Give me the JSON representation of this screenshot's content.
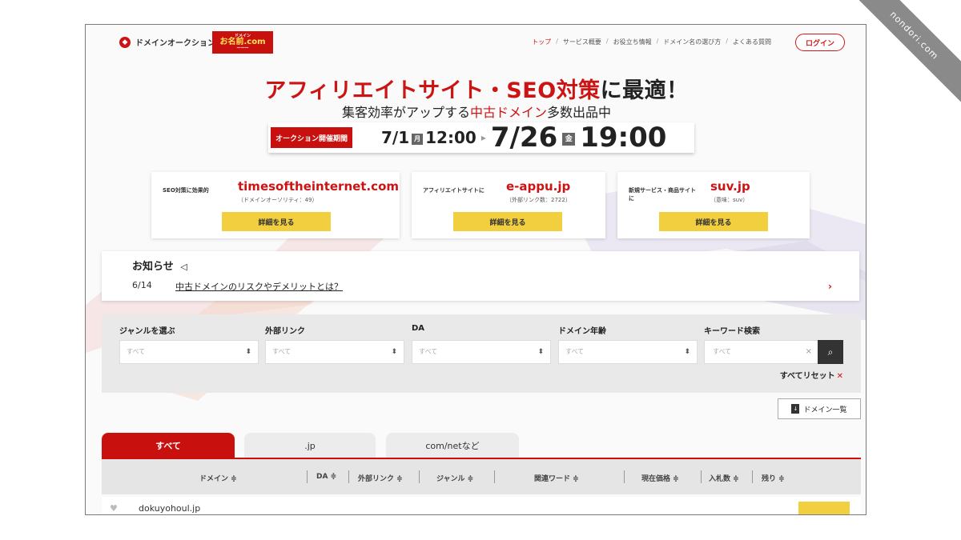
{
  "watermark": "nondori.com",
  "header": {
    "logo_text": "ドメインオークション",
    "partner_logo": "お名前.com",
    "nav": [
      "トップ",
      "サービス概要",
      "お役立ち情報",
      "ドメイン名の選び方",
      "よくある質問"
    ],
    "login_label": "ログイン"
  },
  "hero": {
    "title_red_1": "アフィリエイトサイト・SEO対策",
    "title_black": "に最適！",
    "sub_black_1": "集客効率がアップする",
    "sub_red": "中古ドメイン",
    "sub_black_2": "多数出品中",
    "period_label": "オークション開催期間",
    "start_date": "7/1",
    "start_day": "月",
    "start_time": "12:00",
    "end_date": "7/26",
    "end_day": "金",
    "end_time": "19:00"
  },
  "cards": [
    {
      "tag": "SEO対策に効果的",
      "domain": "timesoftheinternet.com",
      "meta": "（ドメインオーソリティ：49）",
      "button": "詳細を見る"
    },
    {
      "tag": "アフィリエイトサイトに",
      "domain": "e-appu.jp",
      "meta": "（外部リンク数：2722）",
      "button": "詳細を見る"
    },
    {
      "tag": "新規サービス・商品サイトに",
      "domain": "suv.jp",
      "meta": "（意味：suv）",
      "button": "詳細を見る"
    }
  ],
  "news": {
    "title": "お知らせ",
    "date": "6/14",
    "link": "中古ドメインのリスクやデメリットとは？"
  },
  "filters": {
    "labels": [
      "ジャンルを選ぶ",
      "外部リンク",
      "DA",
      "ドメイン年齢",
      "キーワード検索"
    ],
    "select_value": "すべて",
    "keyword_placeholder": "すべて",
    "reset_label": "すべてリセット"
  },
  "domain_list_label": "ドメイン一覧",
  "tabs": [
    "すべて",
    ".jp",
    "com/netなど"
  ],
  "table": {
    "headers": [
      "ドメイン ≑",
      "DA ≑",
      "外部リンク ≑",
      "ジャンル ≑",
      "関連ワード ≑",
      "現在価格 ≑",
      "入札数 ≑",
      "残り ≑"
    ],
    "row": {
      "domain": "dokuyohoul.jp"
    }
  }
}
